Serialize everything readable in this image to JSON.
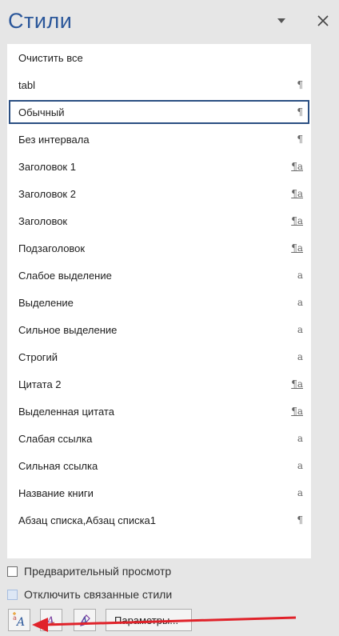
{
  "pane": {
    "title": "Стили"
  },
  "styles": [
    {
      "name": "Очистить все",
      "type_symbol": ""
    },
    {
      "name": "tabl",
      "type_symbol": "¶"
    },
    {
      "name": "Обычный",
      "type_symbol": "¶",
      "selected": true
    },
    {
      "name": "Без интервала",
      "type_symbol": "¶"
    },
    {
      "name": "Заголовок 1",
      "type_symbol": "¶a"
    },
    {
      "name": "Заголовок 2",
      "type_symbol": "¶a"
    },
    {
      "name": "Заголовок",
      "type_symbol": "¶a"
    },
    {
      "name": "Подзаголовок",
      "type_symbol": "¶a"
    },
    {
      "name": "Слабое выделение",
      "type_symbol": "a"
    },
    {
      "name": "Выделение",
      "type_symbol": "a"
    },
    {
      "name": "Сильное выделение",
      "type_symbol": "a"
    },
    {
      "name": "Строгий",
      "type_symbol": "a"
    },
    {
      "name": "Цитата 2",
      "type_symbol": "¶a"
    },
    {
      "name": "Выделенная цитата",
      "type_symbol": "¶a"
    },
    {
      "name": "Слабая ссылка",
      "type_symbol": "a"
    },
    {
      "name": "Сильная ссылка",
      "type_symbol": "a"
    },
    {
      "name": "Название книги",
      "type_symbol": "a"
    },
    {
      "name": "Абзац списка,Абзац списка1",
      "type_symbol": "¶"
    }
  ],
  "options": {
    "preview_label": "Предварительный просмотр",
    "preview_checked": false,
    "disable_linked_label": "Отключить связанные стили",
    "disable_linked_checked": false
  },
  "toolbar": {
    "params_label": "Параметры..."
  },
  "colors": {
    "title": "#2b579a",
    "selection_border": "#2b4f82",
    "annotation_arrow": "#e0222a"
  }
}
